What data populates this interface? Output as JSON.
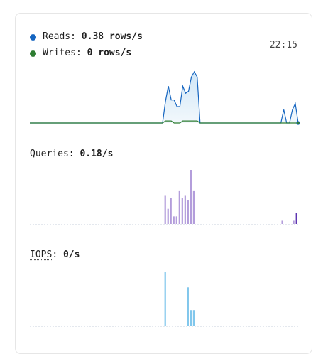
{
  "panel": {
    "time": "22:15",
    "reads": {
      "label": "Reads:",
      "value": "0.38 rows/s",
      "color": "#1565c0"
    },
    "writes": {
      "label": "Writes:",
      "value": "0 rows/s",
      "color": "#2e7d32"
    },
    "queries": {
      "label": "Queries:",
      "value": "0.18/s",
      "color": "#b39ddb",
      "last_color": "#5e35b1"
    },
    "iops": {
      "label": "IOPS",
      "sep": ":",
      "value": "0/s",
      "color": "#81c7ec"
    }
  },
  "chart_data": [
    {
      "type": "area",
      "series": [
        {
          "values": [
            0,
            0,
            0,
            0,
            0,
            0,
            0,
            0,
            0,
            0,
            0,
            0,
            0,
            0,
            0,
            0,
            0,
            0,
            0,
            0,
            0,
            0,
            0,
            0,
            0,
            0,
            0,
            0,
            0,
            0,
            0,
            0,
            0,
            0,
            0,
            0,
            0,
            0,
            0,
            0,
            0,
            0,
            0,
            0,
            0,
            0,
            0,
            0,
            0,
            0,
            0,
            0,
            0,
            0,
            0,
            0,
            0,
            0,
            0,
            0,
            0,
            0,
            0,
            0,
            0,
            0,
            0,
            0,
            0,
            0,
            0,
            0,
            0,
            0,
            0,
            0,
            0,
            0,
            0,
            0,
            0,
            0,
            0,
            0,
            0,
            0,
            0,
            0,
            0,
            0,
            0,
            0,
            0,
            0,
            0,
            0,
            0,
            0,
            0,
            0,
            0,
            0,
            0,
            0,
            0,
            0,
            0,
            0,
            0,
            0,
            0,
            0,
            0,
            0,
            0,
            0,
            0,
            0,
            0,
            0,
            0,
            0,
            0,
            0,
            0,
            0,
            0,
            0,
            0,
            0,
            0,
            0,
            0,
            0,
            0,
            0,
            0,
            0,
            0,
            0,
            0,
            0,
            0,
            0,
            0,
            0,
            0,
            0,
            0,
            0,
            0,
            0,
            0,
            0,
            0,
            0,
            0,
            0,
            0,
            0,
            0,
            0,
            0,
            0,
            0,
            0,
            0,
            0,
            0,
            0,
            0,
            0,
            0,
            0,
            0,
            0,
            0,
            0,
            0,
            0,
            0,
            0,
            0,
            0,
            0,
            0,
            0,
            0,
            0,
            0,
            0,
            0,
            0,
            0,
            0,
            0,
            0,
            0,
            0,
            0,
            0,
            0,
            0,
            0,
            0,
            0,
            0,
            0,
            0,
            0,
            0,
            0,
            0,
            0,
            0,
            0,
            0,
            0,
            0,
            0,
            0,
            0,
            0,
            0,
            0,
            0,
            0,
            0,
            0,
            0,
            0,
            0,
            0,
            0,
            0,
            0,
            0,
            0,
            0,
            0,
            0,
            0,
            0,
            0,
            0,
            0,
            0,
            0,
            0,
            0,
            0,
            0,
            0,
            0,
            0,
            0,
            0,
            0,
            0,
            0,
            0,
            0,
            0,
            0,
            0,
            0,
            0,
            0,
            0,
            0,
            0,
            0,
            0,
            0,
            0,
            0,
            0,
            0,
            0,
            0,
            0,
            0,
            0,
            0,
            0,
            0,
            0,
            0,
            0,
            0,
            0,
            0,
            0,
            0,
            0,
            0,
            0,
            0,
            0,
            0,
            0,
            0,
            0,
            0,
            0,
            0,
            0,
            0,
            0,
            0,
            0,
            0,
            0,
            0,
            0,
            0,
            0,
            0,
            0,
            0,
            0,
            0,
            0,
            0,
            0,
            0,
            0,
            0,
            0,
            0,
            0,
            0,
            0,
            0,
            0,
            0,
            0,
            0,
            0,
            0,
            0,
            0,
            0,
            0,
            0,
            0,
            0,
            0,
            0,
            0,
            0,
            0,
            0,
            0,
            0,
            0,
            0,
            0,
            0,
            0,
            0,
            0,
            0,
            0,
            0,
            0,
            0,
            0,
            0,
            0,
            0,
            0,
            0,
            0,
            0,
            0,
            0,
            0,
            0,
            0,
            0,
            0,
            0,
            0,
            0,
            0,
            0,
            0,
            0,
            0,
            0,
            0,
            0,
            0,
            0,
            0,
            0,
            0,
            0,
            0,
            0,
            0,
            0,
            0,
            0,
            0,
            0,
            0,
            0,
            0,
            0,
            0,
            0,
            0,
            0,
            0,
            0,
            0,
            0,
            0,
            0,
            0,
            0,
            0
          ]
        }
      ]
    }
  ]
}
